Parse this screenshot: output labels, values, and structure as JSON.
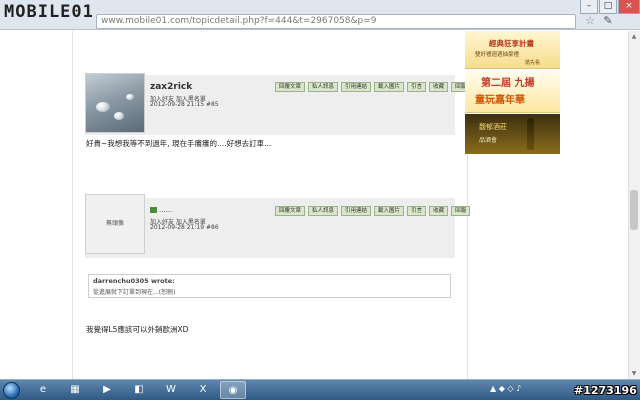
{
  "browser": {
    "watermark": "MOBILE01",
    "url": "www.mobile01.com/topicdetail.php?f=444&t=2967058&p=9",
    "win_minimize": "–",
    "win_maximize": "□",
    "win_close": "×"
  },
  "post1": {
    "username": "zax2rick",
    "links": "加入好友  加入黑名單",
    "datetime": "2012-09-28 21:15 #85",
    "buttons": [
      "回覆文章",
      "私人訊息",
      "引用連結",
      "載入圖片",
      "引言",
      "收藏",
      "回報"
    ],
    "body": "好貴~我想我等不到過年, 現在手癢癢的....好想去訂車..."
  },
  "post2": {
    "avatar_text": "無頭像",
    "username": "......",
    "links": "加入好友  加入黑名單",
    "datetime": "2012-09-28 21:19 #86",
    "buttons": [
      "回覆文章",
      "私人訊息",
      "引用連結",
      "載入圖片",
      "引言",
      "收藏",
      "回報"
    ],
    "quote_author": "darrenchu0305 wrote:",
    "quote_text": "從進展就下訂單到現在...(恕刪)",
    "body": "我覺得L5應該可以外銷歐洲XD"
  },
  "ads": {
    "ad1_line1": "經典狂享計畫",
    "ad1_line2": "雙好禮週週抽豪禮",
    "ad1_line3": "搶先看",
    "ad2_line1": "第二屆 九揚",
    "ad2_line2": "童玩嘉年華",
    "ad3_line1": "馥郁酒莊",
    "ad3_line2": "品酒會"
  },
  "taskbar": {
    "stamp": "#1273196"
  }
}
